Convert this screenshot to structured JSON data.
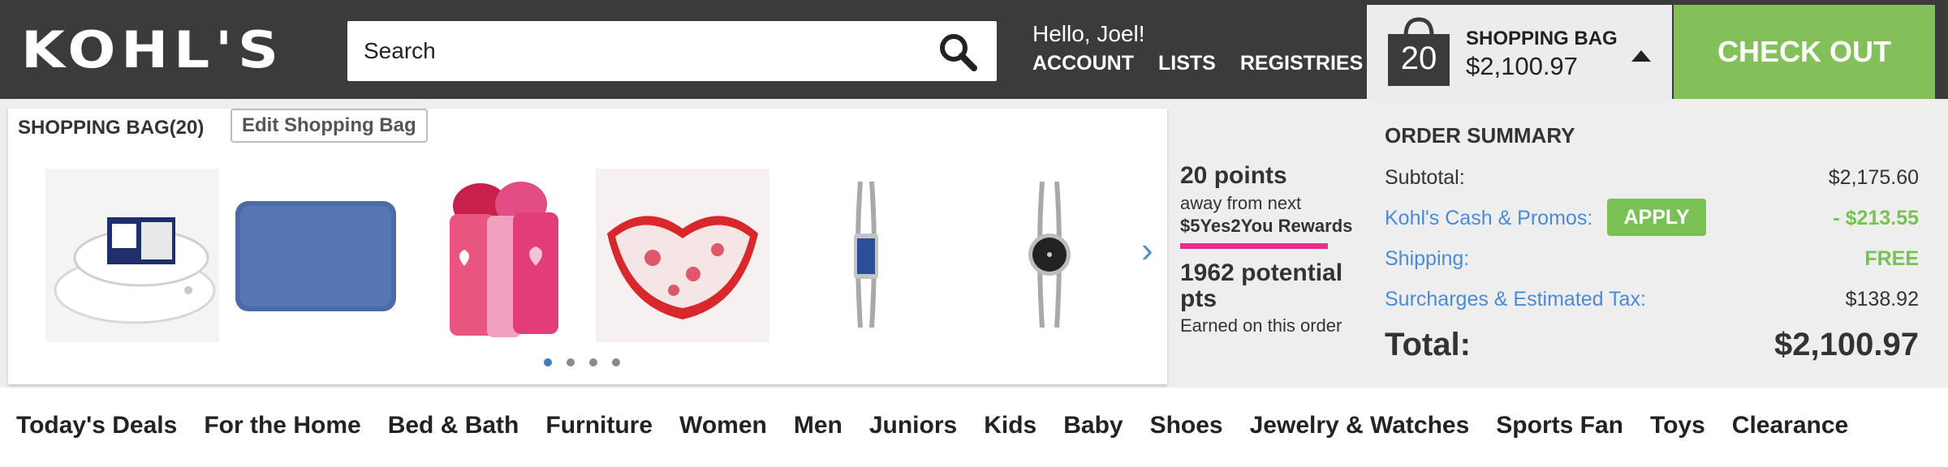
{
  "header": {
    "logo_text": "KOHL'S",
    "search": {
      "placeholder": "Search",
      "value": ""
    },
    "greeting": "Hello, Joel!",
    "links": [
      "ACCOUNT",
      "LISTS",
      "REGISTRIES"
    ],
    "bag": {
      "count": "20",
      "title": "SHOPPING BAG",
      "amount": "$2,100.97"
    },
    "checkout_label": "CHECK OUT"
  },
  "bag_panel": {
    "title": "SHOPPING BAG(20)",
    "edit_label": "Edit Shopping Bag",
    "items": [
      {
        "name": "pillow"
      },
      {
        "name": "blue bath rug"
      },
      {
        "name": "pink towel set"
      },
      {
        "name": "heart bowl"
      },
      {
        "name": "rectangular watch"
      },
      {
        "name": "round watch"
      }
    ],
    "active_page": 1,
    "page_count": 4
  },
  "rewards": {
    "points": "20 points",
    "away_text": "away from next",
    "reward_name": "$5Yes2You Rewards",
    "potential_pts": "1962 potential pts",
    "earned_text": "Earned on this order"
  },
  "order_summary": {
    "title": "ORDER SUMMARY",
    "subtotal_label": "Subtotal:",
    "subtotal": "$2,175.60",
    "kohls_cash_label": "Kohl's Cash & Promos:",
    "apply_label": "APPLY",
    "kohls_cash": "- $213.55",
    "shipping_label": "Shipping:",
    "shipping": "FREE",
    "tax_label": "Surcharges & Estimated Tax:",
    "tax": "$138.92",
    "total_label": "Total:",
    "total": "$2,100.97"
  },
  "nav": {
    "items": [
      "Today's Deals",
      "For the Home",
      "Bed & Bath",
      "Furniture",
      "Women",
      "Men",
      "Juniors",
      "Kids",
      "Baby",
      "Shoes",
      "Jewelry & Watches",
      "Sports Fan",
      "Toys",
      "Clearance"
    ]
  },
  "colors": {
    "header_bg": "#3b3b3b",
    "checkout_green": "#83c05a",
    "link_blue": "#4b8ad6",
    "rewards_pink": "#e62e8a"
  }
}
